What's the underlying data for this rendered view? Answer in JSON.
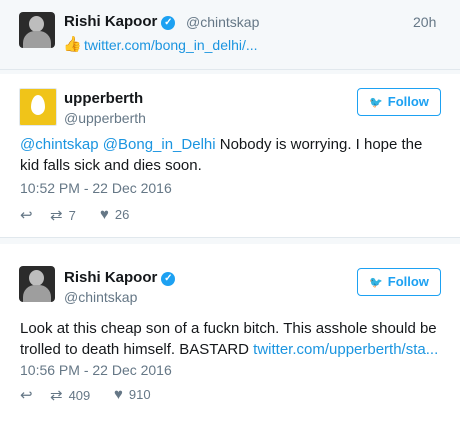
{
  "top_tweet": {
    "name": "Rishi Kapoor",
    "handle": "@chintskap",
    "time_ago": "20h",
    "thumb_icon": "thumbs-up-icon",
    "link": "twitter.com/bong_in_delhi/..."
  },
  "reply_tweet": {
    "name": "upperberth",
    "handle": "@upperberth",
    "follow_label": "Follow",
    "mention1": "@chintskap",
    "mention2": "@Bong_in_Delhi",
    "text": " Nobody is worrying. I hope the kid falls sick and dies soon.",
    "timestamp": "10:52 PM - 22 Dec 2016",
    "retweets": "7",
    "likes": "26"
  },
  "rishi_tweet": {
    "name": "Rishi Kapoor",
    "handle": "@chintskap",
    "follow_label": "Follow",
    "text": "Look at this cheap son of a fuckn bitch. This asshole should be trolled to death himself. BASTARD ",
    "link": "twitter.com/upperberth/sta...",
    "timestamp": "10:56 PM - 22 Dec 2016",
    "retweets": "409",
    "likes": "910"
  },
  "colors": {
    "accent": "#1da1f2",
    "link": "#1b95e0",
    "muted": "#657786"
  }
}
